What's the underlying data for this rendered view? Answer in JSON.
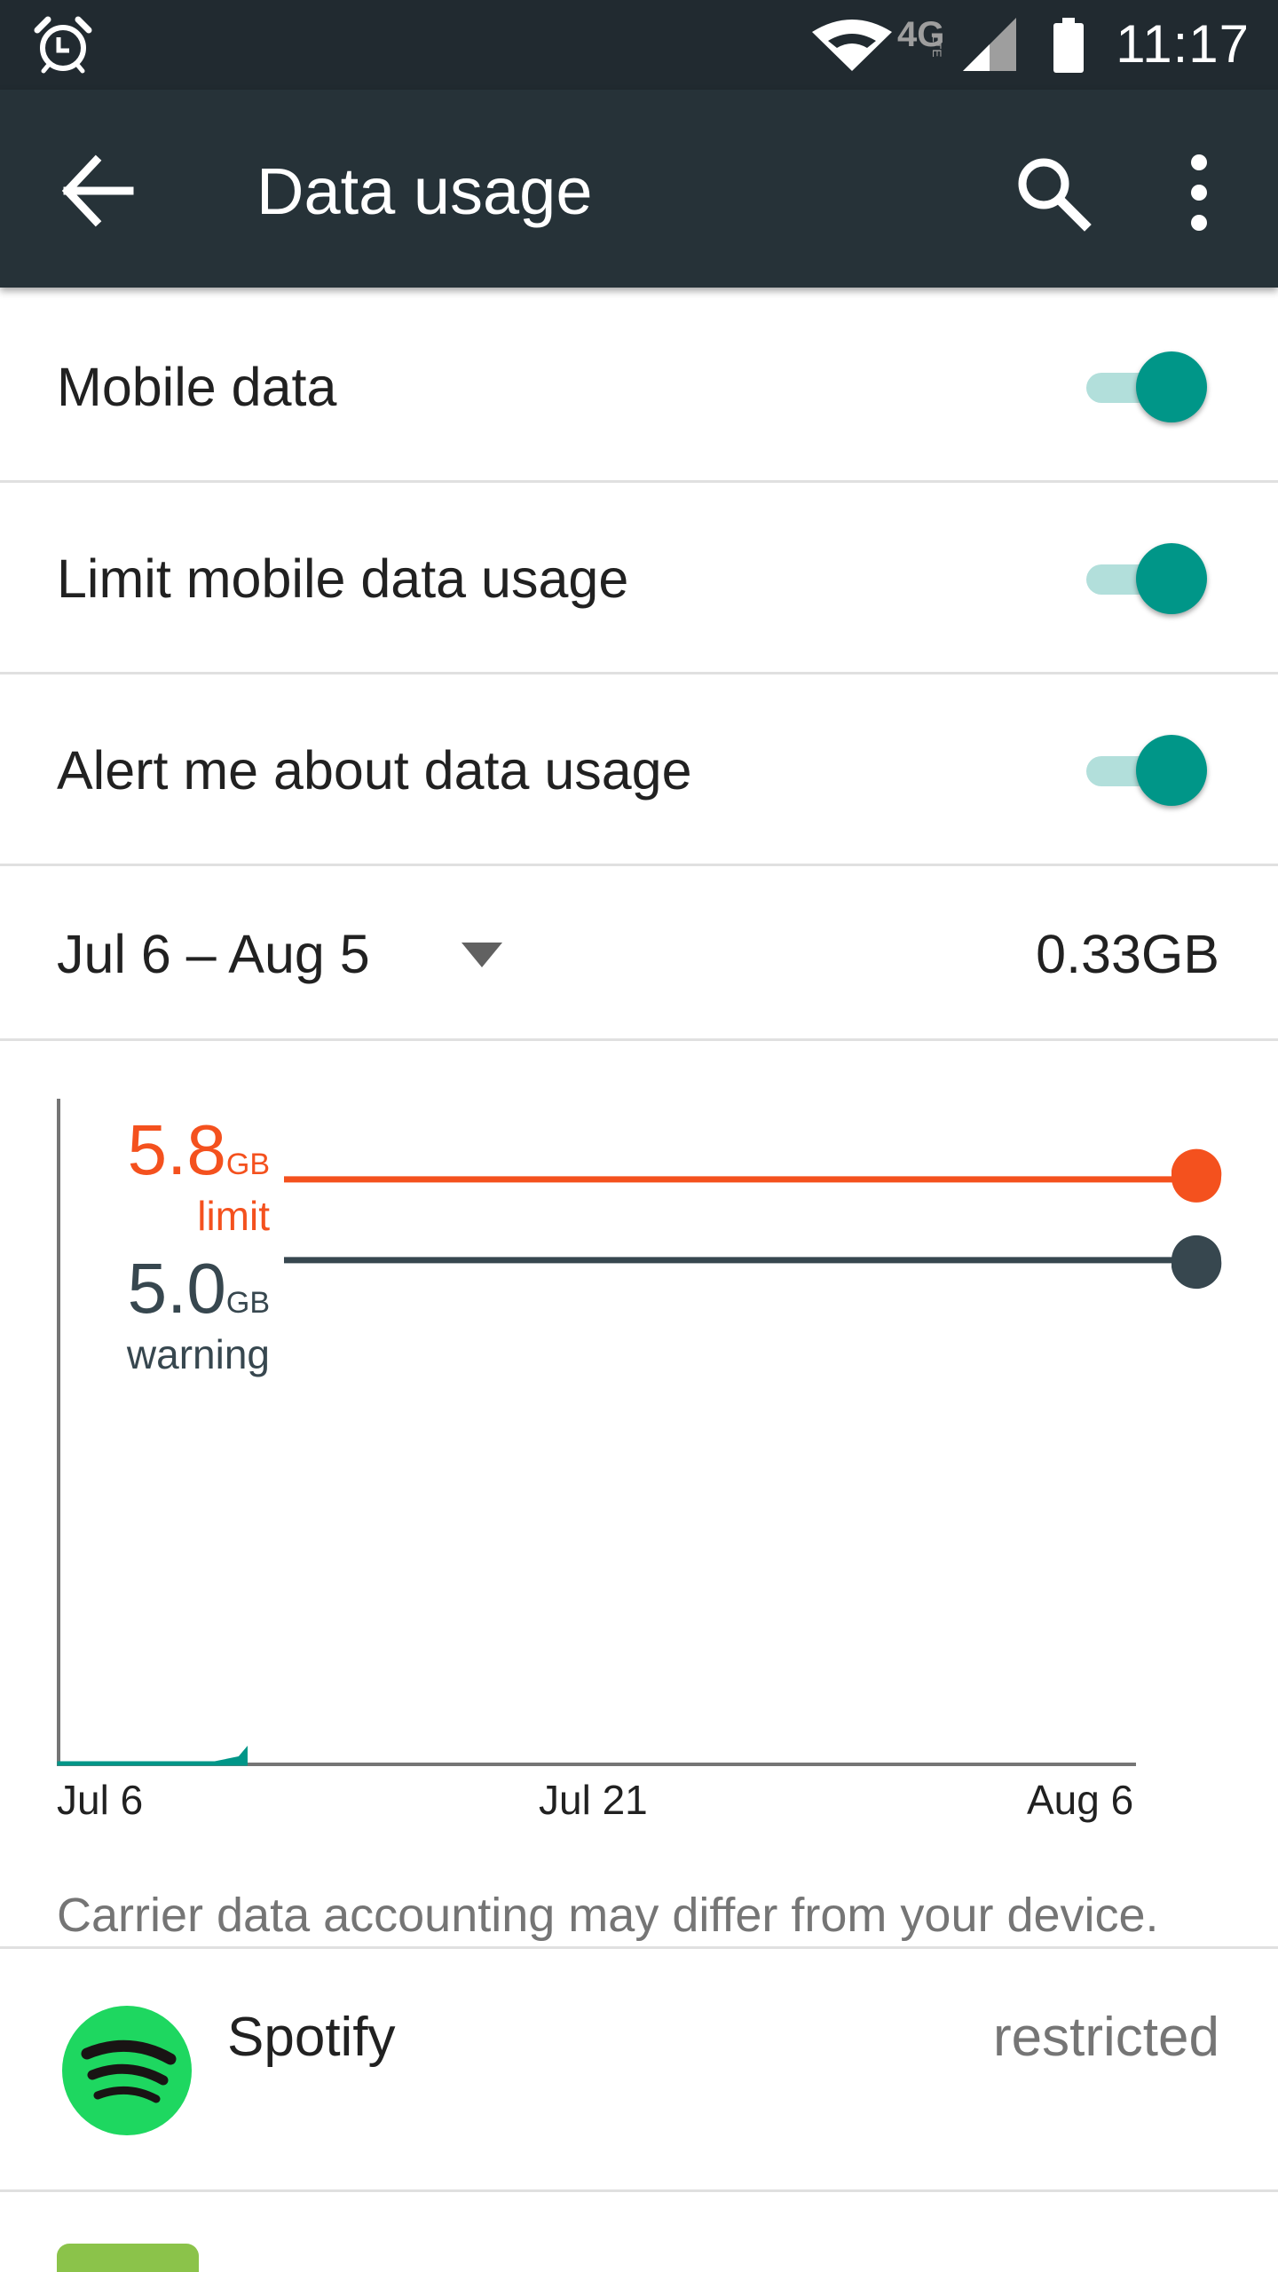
{
  "status_bar": {
    "time": "11:17",
    "network_label": "4G",
    "network_sublabel": "LTE",
    "icons": [
      "alarm-icon",
      "wifi-icon",
      "lte-icon",
      "cell-signal-icon",
      "battery-icon"
    ]
  },
  "app_bar": {
    "title": "Data usage",
    "icons": [
      "back-arrow-icon",
      "search-icon",
      "more-vert-icon"
    ]
  },
  "toggles": [
    {
      "label": "Mobile data",
      "on": true
    },
    {
      "label": "Limit mobile data usage",
      "on": true
    },
    {
      "label": "Alert me about data usage",
      "on": true
    }
  ],
  "cycle": {
    "range": "Jul 6 – Aug 5",
    "total": "0.33GB"
  },
  "chart_data": {
    "type": "area",
    "x_ticks": [
      "Jul 6",
      "Jul 21",
      "Aug 6"
    ],
    "limit": {
      "value": "5.8",
      "unit": "GB",
      "label": "limit",
      "gb": 5.8
    },
    "warning": {
      "value": "5.0",
      "unit": "GB",
      "label": "warning",
      "gb": 5.0
    },
    "usage_series": {
      "x_days": [
        0,
        4.5,
        5.2,
        5.4
      ],
      "y_gb": [
        0,
        0.03,
        0.15,
        0.33
      ]
    },
    "ylim": [
      0,
      6.6
    ],
    "x_range_days": [
      0,
      31
    ]
  },
  "disclaimer": "Carrier data accounting may differ from your device.",
  "apps": [
    {
      "name": "Spotify",
      "status": "restricted"
    }
  ],
  "colors": {
    "status_bar": "#212a30",
    "app_bar": "#263238",
    "accent": "#009688",
    "track": "#b2dfdb",
    "limit": "#f4511e",
    "warning": "#37474f",
    "spotify": "#1ed760"
  }
}
